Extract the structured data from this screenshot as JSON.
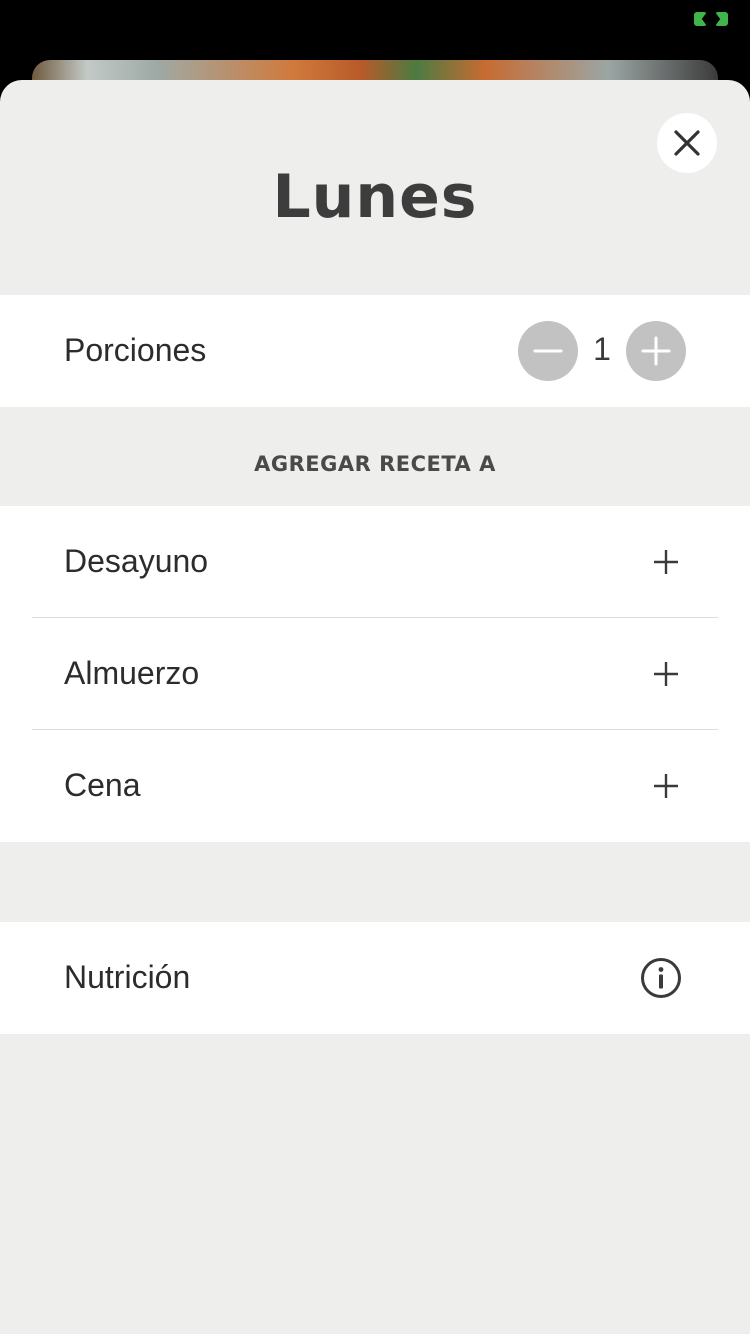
{
  "sheet": {
    "title": "Lunes"
  },
  "servings": {
    "label": "Porciones",
    "value": "1"
  },
  "add_recipe": {
    "header": "AGREGAR RECETA A",
    "meals": [
      {
        "label": "Desayuno"
      },
      {
        "label": "Almuerzo"
      },
      {
        "label": "Cena"
      }
    ]
  },
  "nutrition": {
    "label": "Nutrición"
  },
  "icons": [
    "close-icon",
    "minus-icon",
    "plus-icon",
    "info-icon"
  ],
  "colors": {
    "sheet_background": "#eeeeed",
    "row_background": "#ffffff",
    "stepper_button": "#c2c2c2",
    "text": "#2c2c2c",
    "status_indicator": "#3fb54a"
  }
}
